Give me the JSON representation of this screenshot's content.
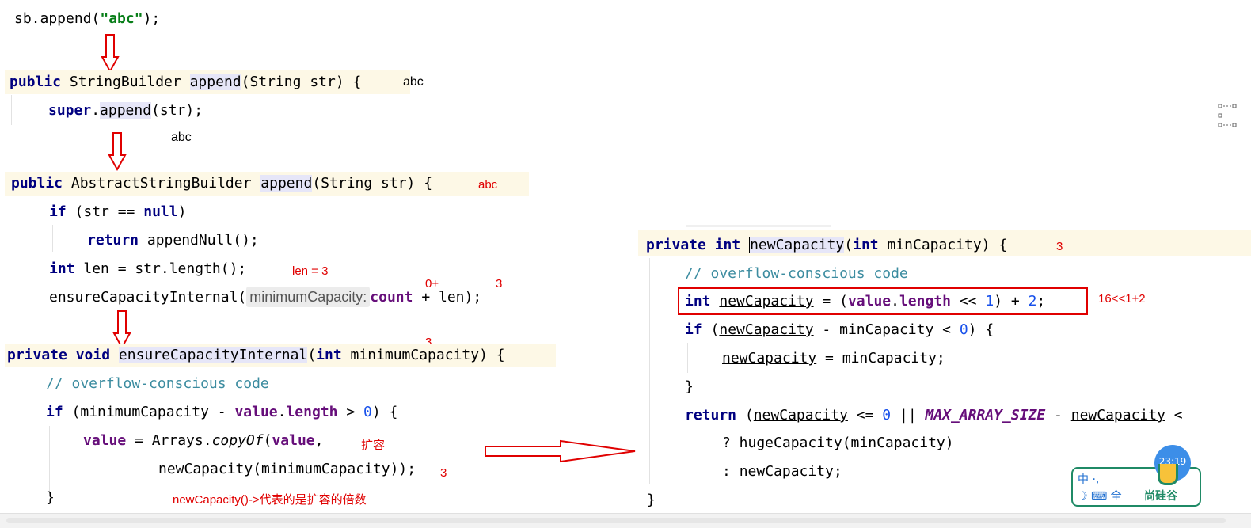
{
  "code_left": {
    "call": [
      "sb.append(",
      "\"abc\"",
      ");"
    ],
    "block1": {
      "sig": [
        "public",
        " StringBuilder ",
        "append",
        "(String str) {"
      ],
      "body": [
        "super",
        ".",
        "append",
        "(str);"
      ],
      "note_sig": "abc",
      "note_below": "abc"
    },
    "block2": {
      "sig": [
        "public",
        " AbstractStringBuilder ",
        "append",
        "(String str) {"
      ],
      "note_sig": "abc",
      "l1": [
        "if",
        " (str == ",
        "null",
        ")"
      ],
      "l2": [
        "return",
        " appendNull();"
      ],
      "l3": [
        "int",
        " len = str.length();"
      ],
      "note_len": "len = 3",
      "l4_a": "ensureCapacityInternal(",
      "hint": "minimumCapacity:",
      "l4_b": [
        "count",
        " + len);"
      ],
      "note_count": "0+",
      "note_len2": "3"
    },
    "block3": {
      "sig": [
        "private",
        " ",
        "void",
        " ",
        "ensureCapacityInternal",
        "(",
        "int",
        " minimumCapacity) {"
      ],
      "note_sig": "3",
      "comment": "// overflow-conscious code",
      "l1": [
        "if",
        " (minimumCapacity - ",
        "value",
        ".",
        "length",
        " > ",
        "0",
        ") {"
      ],
      "l2": [
        "value",
        " = Arrays.",
        "copyOf",
        "(",
        "value",
        ","
      ],
      "note_expand": "扩容",
      "l3": "newCapacity(minimumCapacity));",
      "note_l3": "3",
      "close": "}",
      "note_bottom": "newCapacity()->代表的是扩容的倍数"
    }
  },
  "code_right": {
    "sig": [
      "private",
      " ",
      "int",
      " ",
      "newCapacity",
      "(",
      "int",
      " minCapacity) {"
    ],
    "note_sig": "3",
    "comment": "// overflow-conscious code",
    "l1": [
      "int",
      " ",
      "newCapacity",
      " = (",
      "value",
      ".",
      "length",
      " << ",
      "1",
      ") + ",
      "2",
      ";"
    ],
    "note_l1": "16<<1+2",
    "l2": [
      "if",
      " (",
      "newCapacity",
      " - minCapacity < ",
      "0",
      ") {"
    ],
    "l3": [
      "newCapacity",
      " = minCapacity;"
    ],
    "l4": "}",
    "l5": [
      "return",
      " (",
      "newCapacity",
      " <= ",
      "0",
      " || ",
      "MAX_ARRAY_SIZE",
      " - ",
      "newCapacity",
      " <"
    ],
    "l6": "? hugeCapacity(minCapacity)",
    "l7": [
      ": ",
      "newCapacity",
      ";"
    ],
    "close": "}"
  },
  "widget": {
    "time": "23:19",
    "row1": "中 ·, ",
    "row2": "☽ ⌨ 全",
    "brand": "尚硅谷"
  },
  "colors": {
    "keyword": "#000080",
    "field": "#660e7a",
    "string": "#067d17",
    "comment": "#3c8ca0",
    "number": "#1750eb",
    "annotation": "#e00000",
    "line_highlight": "#fdf8e6",
    "method_highlight": "#e6e6f8",
    "box": "#e00000",
    "widget_green": "#1f8a66"
  }
}
